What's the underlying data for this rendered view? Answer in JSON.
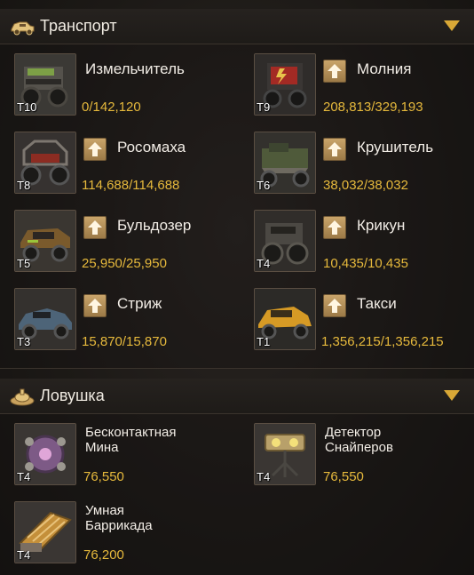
{
  "transport": {
    "title": "Транспорт",
    "items": [
      {
        "name": "Измельчитель",
        "count": "0/142,120",
        "tier": "T10",
        "upgrade": false
      },
      {
        "name": "Молния",
        "count": "208,813/329,193",
        "tier": "T9",
        "upgrade": true
      },
      {
        "name": "Росомаха",
        "count": "114,688/114,688",
        "tier": "T8",
        "upgrade": true
      },
      {
        "name": "Крушитель",
        "count": "38,032/38,032",
        "tier": "T6",
        "upgrade": true
      },
      {
        "name": "Бульдозер",
        "count": "25,950/25,950",
        "tier": "T5",
        "upgrade": true
      },
      {
        "name": "Крикун",
        "count": "10,435/10,435",
        "tier": "T4",
        "upgrade": true
      },
      {
        "name": "Стриж",
        "count": "15,870/15,870",
        "tier": "T3",
        "upgrade": true
      },
      {
        "name": "Такси",
        "count": "1,356,215/1,356,215",
        "tier": "T1",
        "upgrade": true
      }
    ]
  },
  "trap": {
    "title": "Ловушка",
    "items": [
      {
        "name": "Бесконтактная\nМина",
        "count": "76,550",
        "tier": "T4"
      },
      {
        "name": "Детектор\nСнайперов",
        "count": "76,550",
        "tier": "T4"
      },
      {
        "name": "Умная\nБаррикада",
        "count": "76,200",
        "tier": "T4"
      }
    ]
  },
  "colors": {
    "accent": "#e6b93c",
    "chevron": "#d9a836"
  }
}
